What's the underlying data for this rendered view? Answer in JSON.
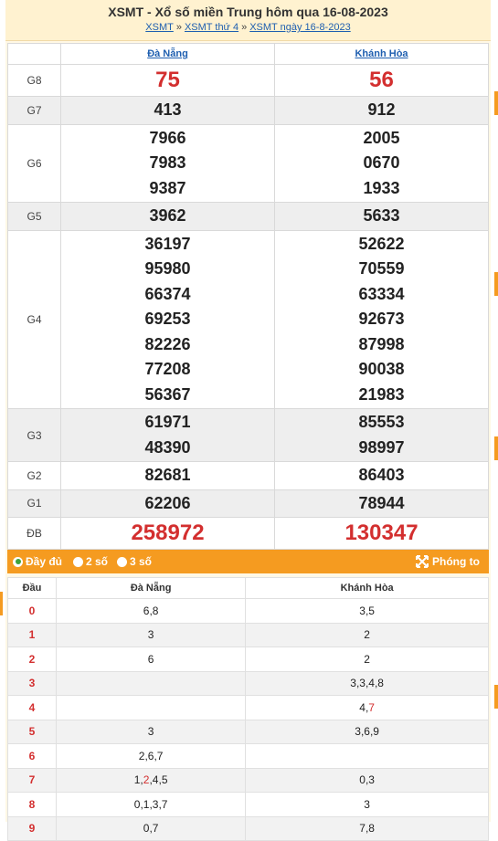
{
  "header": {
    "title": "XSMT - Xổ số miền Trung hôm qua 16-08-2023",
    "crumbs": [
      "XSMT",
      "XSMT thứ 4",
      "XSMT ngày 16-8-2023"
    ],
    "separator": "»"
  },
  "provinces": [
    "Đà Nẵng",
    "Khánh Hòa"
  ],
  "prizes": [
    {
      "label": "G8",
      "a": [
        "75"
      ],
      "b": [
        "56"
      ]
    },
    {
      "label": "G7",
      "a": [
        "413"
      ],
      "b": [
        "912"
      ]
    },
    {
      "label": "G6",
      "a": [
        "7966",
        "7983",
        "9387"
      ],
      "b": [
        "2005",
        "0670",
        "1933"
      ]
    },
    {
      "label": "G5",
      "a": [
        "3962"
      ],
      "b": [
        "5633"
      ]
    },
    {
      "label": "G4",
      "a": [
        "36197",
        "95980",
        "66374",
        "69253",
        "82226",
        "77208",
        "56367"
      ],
      "b": [
        "52622",
        "70559",
        "63334",
        "92673",
        "87998",
        "90038",
        "21983"
      ]
    },
    {
      "label": "G3",
      "a": [
        "61971",
        "48390"
      ],
      "b": [
        "85553",
        "98997"
      ]
    },
    {
      "label": "G2",
      "a": [
        "82681"
      ],
      "b": [
        "86403"
      ]
    },
    {
      "label": "G1",
      "a": [
        "62206"
      ],
      "b": [
        "78944"
      ]
    },
    {
      "label": "ĐB",
      "a": [
        "258972"
      ],
      "b": [
        "130347"
      ]
    }
  ],
  "options": {
    "full": "Đầy đủ",
    "two": "2 số",
    "three": "3 số",
    "zoom": "Phóng to"
  },
  "stats": {
    "head_label": "Đầu",
    "rows": [
      {
        "head": "0",
        "a": "6,8",
        "b": "3,5"
      },
      {
        "head": "1",
        "a": "3",
        "b": "2"
      },
      {
        "head": "2",
        "a": "6",
        "b": "2"
      },
      {
        "head": "3",
        "a": "",
        "b": "3,3,4,8"
      },
      {
        "head": "4",
        "a": "",
        "b": "4,7",
        "b_red_last": true
      },
      {
        "head": "5",
        "a": "3",
        "b": "3,6,9"
      },
      {
        "head": "6",
        "a": "2,6,7",
        "b": ""
      },
      {
        "head": "7",
        "a": "1,2,4,5",
        "a_red_index": 1,
        "b": "0,3"
      },
      {
        "head": "8",
        "a": "0,1,3,7",
        "b": "3"
      },
      {
        "head": "9",
        "a": "0,7",
        "b": "7,8"
      }
    ]
  },
  "colors": {
    "accent": "#f59b20",
    "red": "#d32f2f",
    "link": "#1f5fb0"
  }
}
